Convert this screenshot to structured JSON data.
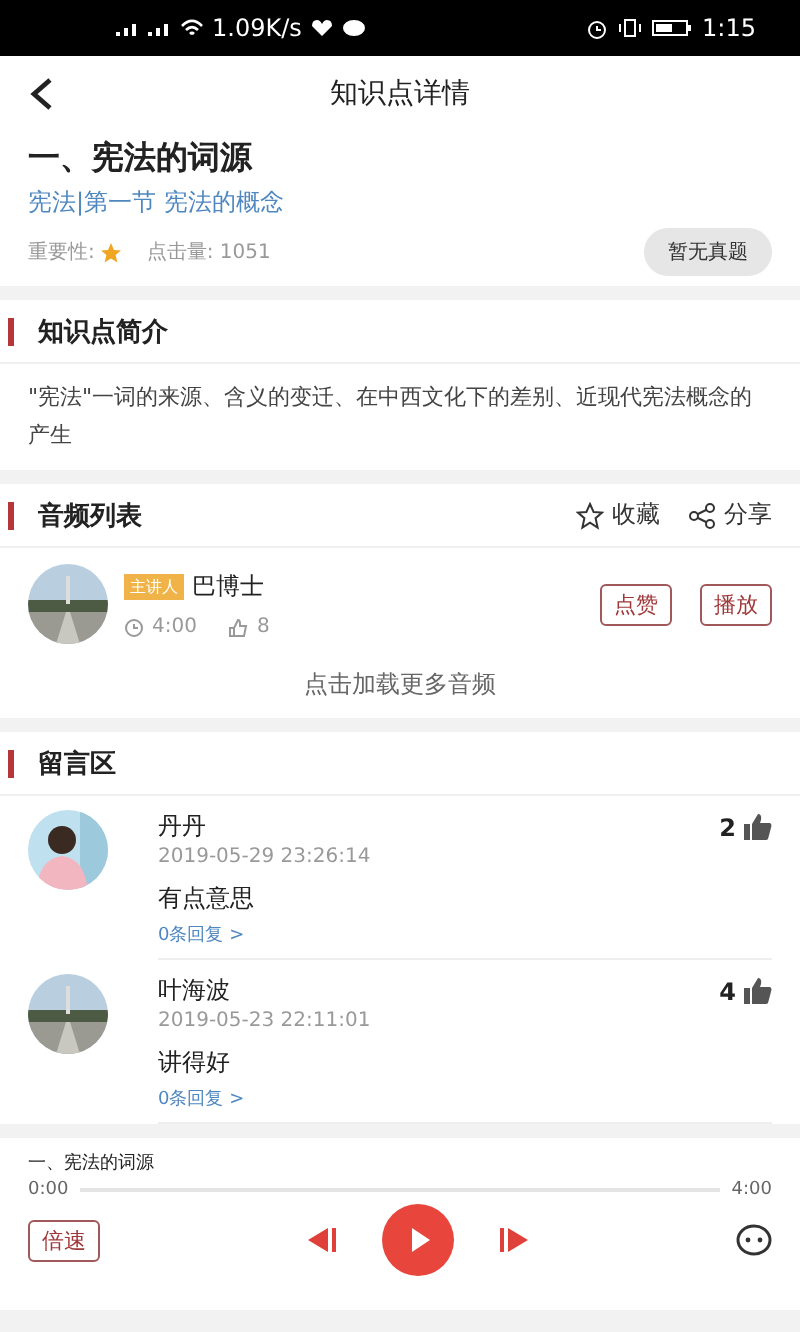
{
  "status_bar": {
    "network_speed": "1.09K/s",
    "time": "1:15"
  },
  "header": {
    "title": "知识点详情"
  },
  "topic": {
    "title": "一、宪法的词源",
    "path": "宪法|第一节 宪法的概念",
    "importance_label": "重要性:",
    "clicks": "点击量: 1051",
    "exam_button": "暂无真题"
  },
  "intro": {
    "heading": "知识点简介",
    "text": "\"宪法\"一词的来源、含义的变迁、在中西文化下的差别、近现代宪法概念的产生"
  },
  "audio": {
    "heading": "音频列表",
    "favorite": "收藏",
    "share": "分享",
    "items": [
      {
        "badge": "主讲人",
        "speaker": "巴博士",
        "duration": "4:00",
        "likes": "8",
        "like_button": "点赞",
        "play_button": "播放"
      }
    ],
    "load_more": "点击加载更多音频"
  },
  "comments": {
    "heading": "留言区",
    "items": [
      {
        "name": "丹丹",
        "time": "2019-05-29 23:26:14",
        "likes": "2",
        "text": "有点意思",
        "replies": "0条回复 >"
      },
      {
        "name": "叶海波",
        "time": "2019-05-23 22:11:01",
        "likes": "4",
        "text": "讲得好",
        "replies": "0条回复 >"
      }
    ]
  },
  "player": {
    "title": "一、宪法的词源",
    "elapsed": "0:00",
    "total": "4:00",
    "level": 0,
    "speed_button": "倍速"
  }
}
